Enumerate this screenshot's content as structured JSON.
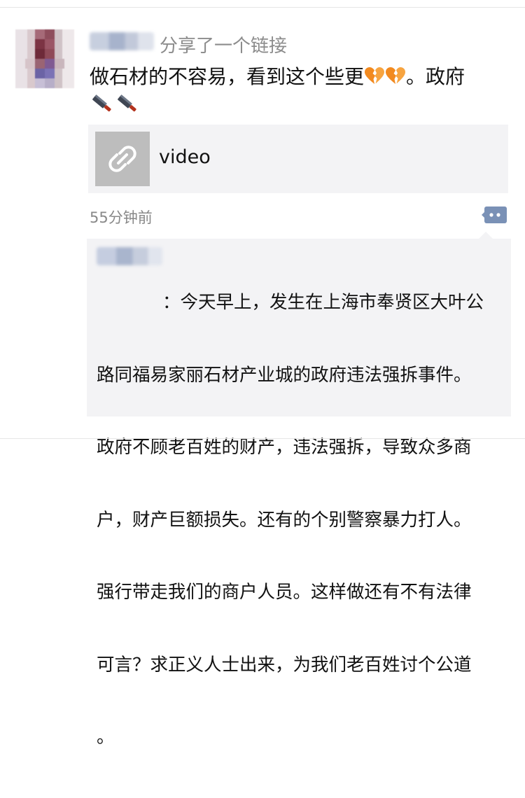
{
  "moment": {
    "share_action": "分享了一个链接",
    "post_text_line1": "做石材的不容易，看到这个些更",
    "post_text_line1_tail": "。政府",
    "emojis": [
      "broken-heart",
      "broken-heart",
      "knife",
      "knife"
    ],
    "link": {
      "title": "video",
      "icon": "link-icon"
    },
    "timestamp": "55分钟前",
    "comment_icon": "comment-icon"
  },
  "comment": {
    "lines": [
      "：今天早上，发生在上海市奉贤区大叶公",
      "路同福易家丽石材产业城的政府违法强拆事件。",
      "政府不顾老百姓的财产，违法强拆，导致众多商",
      "户，财产巨额损失。还有的个别警察暴力打人。",
      "强行带走我们的商户人员。这样做还有不有法律",
      "可言？求正义人士出来，为我们老百姓讨个公道",
      "。"
    ]
  },
  "colors": {
    "accent_blue": "#576b95",
    "muted_gray": "#8c8c8c",
    "card_bg": "#f3f3f5",
    "comment_button": "#7a91b6"
  }
}
